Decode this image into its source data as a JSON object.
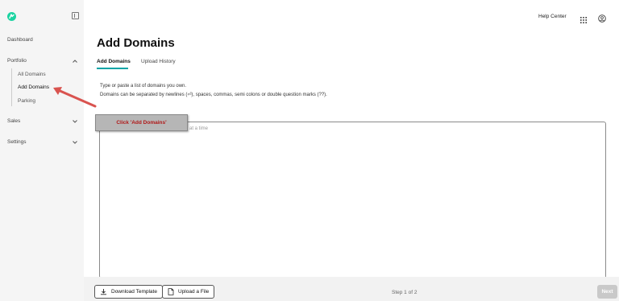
{
  "sidebar": {
    "items": {
      "dashboard": "Dashboard",
      "portfolio": "Portfolio",
      "all_domains": "All Domains",
      "add_domains": "Add Domains",
      "parking": "Parking",
      "sales": "Sales",
      "settings": "Settings"
    }
  },
  "header": {
    "help_center": "Help Center"
  },
  "main": {
    "title": "Add Domains",
    "tabs": [
      "Add Domains",
      "Upload History"
    ],
    "instructions": [
      "Type or paste a list of domains you own.",
      "Domains can be separated by newlines (⏎), spaces, commas, semi colons or double question marks (??)."
    ],
    "textarea_placeholder_visible": "at a time"
  },
  "callout": {
    "text": "Click 'Add Domains'"
  },
  "footer": {
    "download_template": "Download Template",
    "upload_file": "Upload a File",
    "step": "Step 1 of 2",
    "next": "Next"
  },
  "colors": {
    "accent_teal": "#00a4a6",
    "logo_green": "#1bd3a1",
    "callout_text": "#b01919",
    "arrow": "#d9534f"
  },
  "icons": {
    "logo": "brand-logo-icon",
    "collapse": "sidebar-collapse-icon",
    "chevrons": "chevron-icon",
    "apps": "grid-apps-icon",
    "account": "user-account-icon",
    "download": "download-icon",
    "file": "file-icon"
  }
}
